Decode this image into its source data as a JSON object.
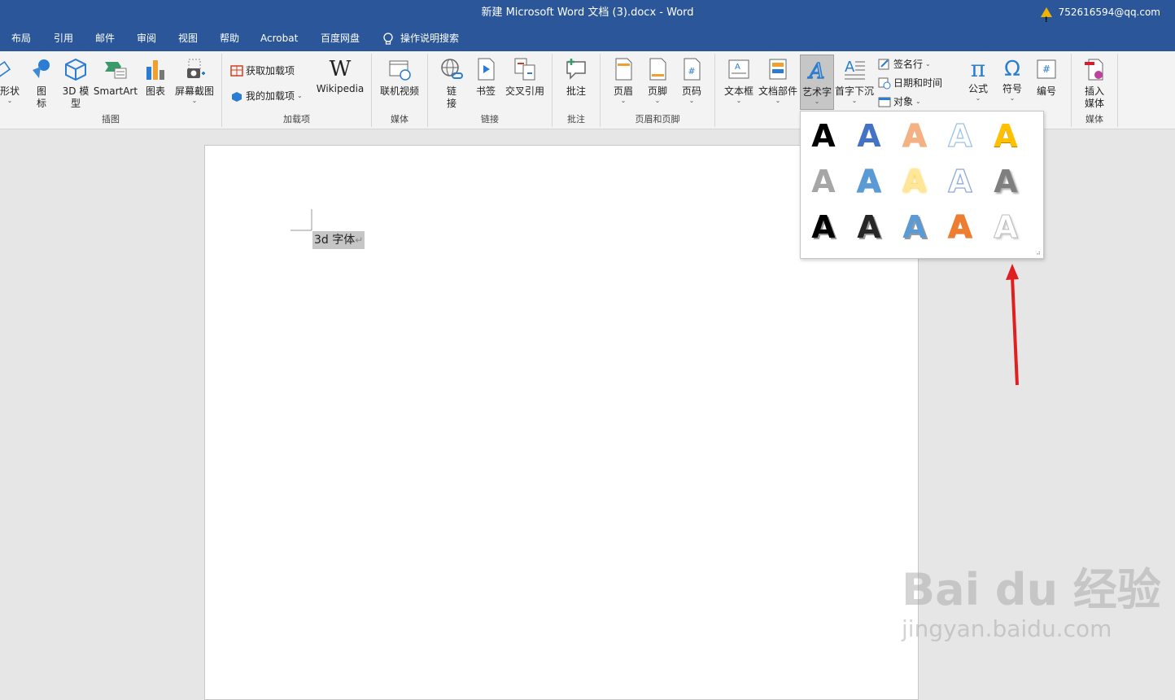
{
  "title_bar": {
    "title": "新建 Microsoft Word 文档 (3).docx  -  Word",
    "account": "752616594@qq.com",
    "warning_icon": "warning-icon"
  },
  "menu": {
    "items": [
      "布局",
      "引用",
      "邮件",
      "审阅",
      "视图",
      "帮助",
      "Acrobat",
      "百度网盘"
    ],
    "search_label": "操作说明搜索"
  },
  "ribbon": {
    "illustrations": {
      "label": "插图",
      "shapes": "形状",
      "icons": "图\n标",
      "model3d": "3D 模\n型",
      "smartart": "SmartArt",
      "chart": "图表",
      "screenshot": "屏幕截图"
    },
    "addins": {
      "label": "加载项",
      "get": "获取加载项",
      "mine": "我的加载项",
      "wikipedia": "Wikipedia"
    },
    "media": {
      "label": "媒体",
      "online_video": "联机视频"
    },
    "links": {
      "label": "链接",
      "link": "链\n接",
      "bookmark": "书签",
      "cross_ref": "交叉引用"
    },
    "comments": {
      "label": "批注",
      "comment": "批注"
    },
    "header_footer": {
      "label": "页眉和页脚",
      "header": "页眉",
      "footer": "页脚",
      "page_number": "页码"
    },
    "text": {
      "textbox": "文本框",
      "quick_parts": "文档部件",
      "wordart": "艺术字",
      "dropcap": "首字下沉",
      "signature": "签名行",
      "datetime": "日期和时间",
      "object": "对象"
    },
    "symbols": {
      "equation": "公式",
      "symbol": "符号",
      "number": "编号"
    },
    "media2": {
      "label": "媒体",
      "insert_media": "插入\n媒体"
    }
  },
  "document": {
    "selected_text": "3d 字体",
    "paragraph_mark": "↵"
  },
  "wordart_gallery": {
    "glyph": "A",
    "styles": [
      [
        "#000000",
        "#4472c4",
        "#f4b183",
        "#9dc3e6",
        "#ffc000"
      ],
      [
        "#a6a6a6",
        "#5b9bd5",
        "#ffe699",
        "#8faadc",
        "#7f7f7f"
      ],
      [
        "#000000",
        "#262626",
        "#5b9bd5",
        "#ed7d31",
        "#d9d9d9"
      ]
    ]
  },
  "watermark": {
    "line1": "Bai du 经验",
    "line2": "jingyan.baidu.com"
  },
  "accent": {
    "title_blue": "#2b579a",
    "arrow_red": "#e02020"
  }
}
